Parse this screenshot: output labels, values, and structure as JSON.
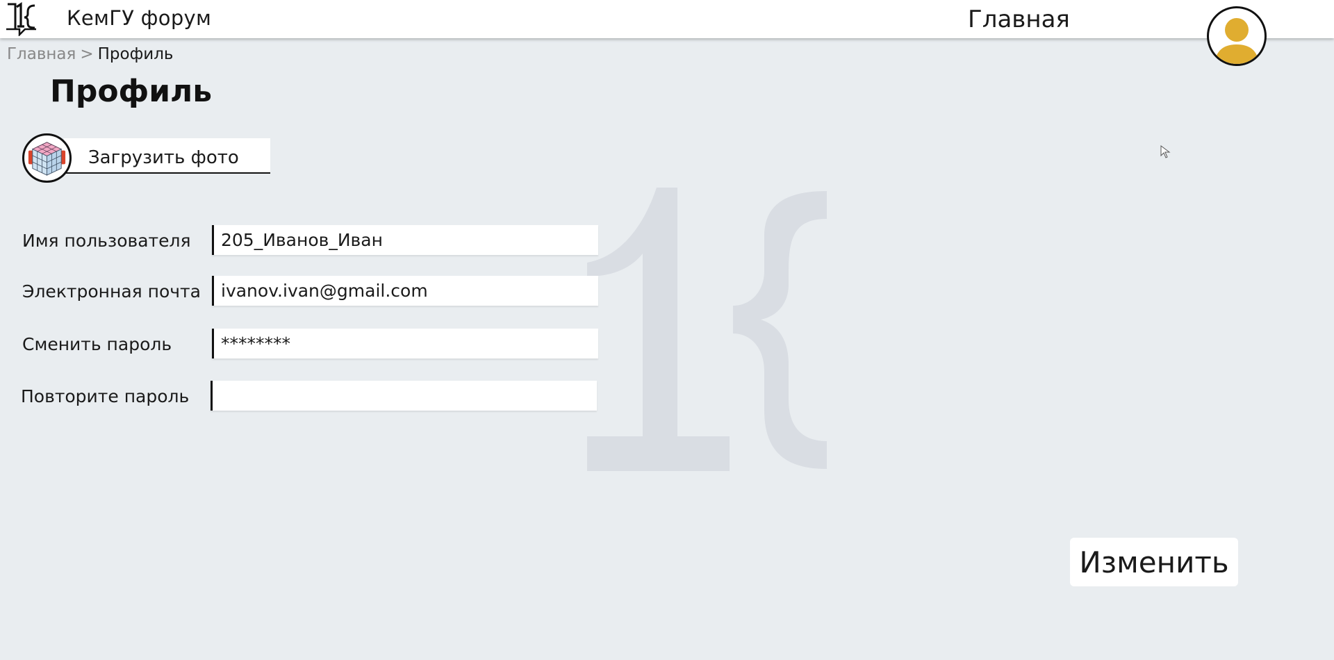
{
  "header": {
    "logo_icon": "1c-logo-icon",
    "app_title": "КемГУ форум",
    "nav_home": "Главная",
    "avatar_icon": "user-avatar-icon",
    "avatar_color": "#e0ad30"
  },
  "breadcrumb": {
    "home": "Главная",
    "separator": ">",
    "current": "Профиль"
  },
  "page_title": "Профиль",
  "upload": {
    "label": "Загрузить фото",
    "avatar_icon": "rubiks-cube-avatar-icon"
  },
  "form": {
    "fields": [
      {
        "label": "Имя пользователя",
        "value": "205_Иванов_Иван"
      },
      {
        "label": "Электронная почта",
        "value": "ivanov.ivan@gmail.com"
      },
      {
        "label": "Сменить пароль",
        "value": "********"
      },
      {
        "label": "Повторите пароль",
        "value": ""
      }
    ]
  },
  "submit_label": "Изменить",
  "colors": {
    "background": "#e9edf0",
    "watermark": "#d9dde3",
    "avatar_yellow": "#e0ad30"
  }
}
